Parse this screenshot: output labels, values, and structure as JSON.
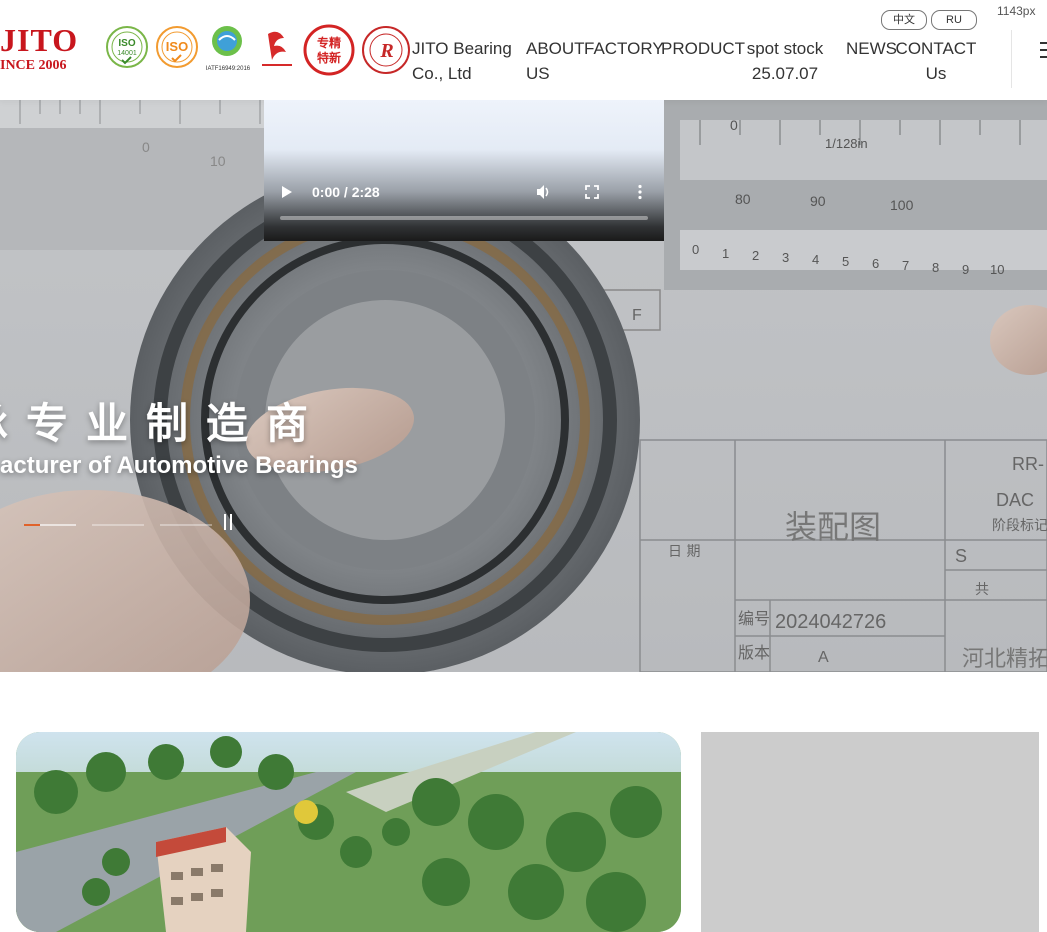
{
  "viewport_label": "1143px",
  "logo": {
    "brand": "JITO",
    "since": "INCE 2006"
  },
  "certs": [
    {
      "name": "iso-14001-badge",
      "text": "ISO",
      "sub": "14001"
    },
    {
      "name": "iso-badge",
      "text": "ISO",
      "sub": ""
    },
    {
      "name": "iatf-badge",
      "text": "",
      "sub": "IATF16949:2016"
    },
    {
      "name": "national-hightech-badge",
      "text": "",
      "sub": ""
    },
    {
      "name": "specialized-new-badge",
      "text": "专精",
      "sub": "特新"
    },
    {
      "name": "registered-r-badge",
      "text": "R",
      "sub": ""
    }
  ],
  "nav": [
    {
      "line1": "JITO Bearing",
      "line2": "Co., Ltd"
    },
    {
      "line1": "ABOUT",
      "line2": "US"
    },
    {
      "line1": "FACTORY",
      "line2": ""
    },
    {
      "line1": "PRODUCT",
      "line2": ""
    },
    {
      "line1": "spot stock",
      "line2": "25.07.07"
    },
    {
      "line1": "NEWS",
      "line2": ""
    },
    {
      "line1": "CONTACT",
      "line2": "Us"
    }
  ],
  "lang": {
    "zh": "中文",
    "ru": "RU"
  },
  "video": {
    "time": "0:00 / 2:28",
    "progress": 0.0
  },
  "hero": {
    "headline_cn": "承专业制造商",
    "headline_en": "acturer of Automotive Bearings",
    "caliper_text": "1/128in",
    "drawing_title": "装配图",
    "drawing_number": "2024042726",
    "drawing_label_no": "编号",
    "drawing_label_ver": "版本",
    "drawing_ver": "A",
    "drawing_company": "河北精拓",
    "drawing_date": "日 期",
    "drawing_stage": "阶段标记",
    "drawing_rr": "RR-",
    "drawing_dac": "DAC",
    "slides": 3,
    "active_slide": 0
  },
  "colors": {
    "brand_red": "#c8161d",
    "dot_accent": "#e0622a"
  }
}
